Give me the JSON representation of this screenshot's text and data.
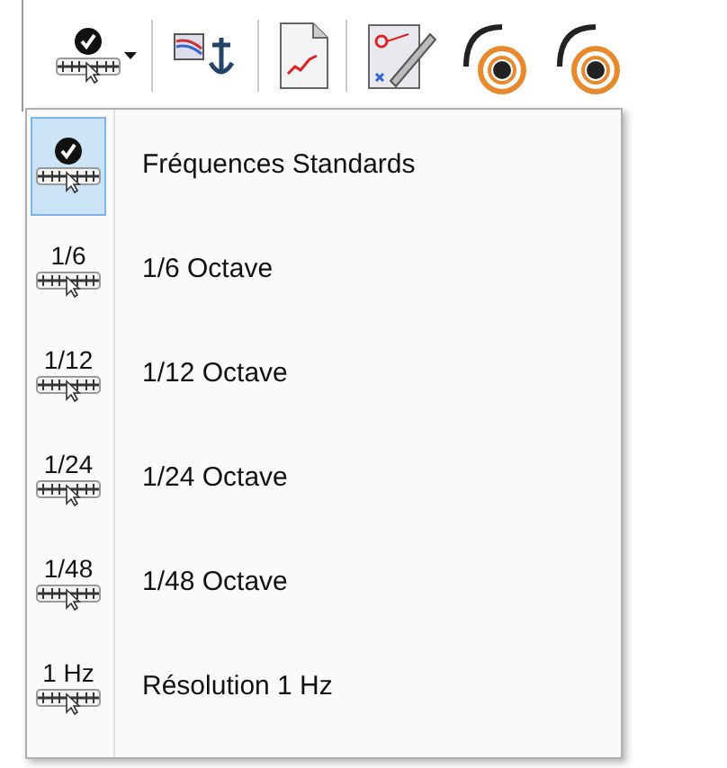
{
  "toolbar": {
    "buttons": [
      {
        "kind": "dropdown"
      },
      {
        "kind": "plain"
      },
      {
        "kind": "plain"
      },
      {
        "kind": "plain"
      },
      {
        "kind": "plain"
      },
      {
        "kind": "plain"
      }
    ]
  },
  "menu": {
    "items": [
      {
        "kind": "check",
        "label": "Fréquences Standards",
        "selected": true
      },
      {
        "kind": "text",
        "badge": "1/6",
        "label": "1/6 Octave",
        "selected": false
      },
      {
        "kind": "text",
        "badge": "1/12",
        "label": "1/12 Octave",
        "selected": false
      },
      {
        "kind": "text",
        "badge": "1/24",
        "label": "1/24 Octave",
        "selected": false
      },
      {
        "kind": "text",
        "badge": "1/48",
        "label": "1/48 Octave",
        "selected": false
      },
      {
        "kind": "text",
        "badge": "1 Hz",
        "label": "Résolution 1 Hz",
        "selected": false
      }
    ]
  }
}
